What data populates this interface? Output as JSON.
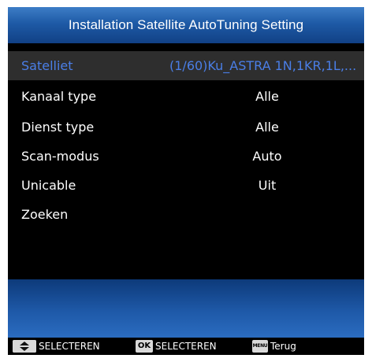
{
  "header": {
    "title": "Installation Satellite AutoTuning Setting"
  },
  "menu": {
    "items": [
      {
        "label": "Satelliet",
        "value": "(1/60)Ku_ASTRA 1N,1KR,1L,..."
      },
      {
        "label": "Kanaal type",
        "value": "Alle"
      },
      {
        "label": "Dienst type",
        "value": "Alle"
      },
      {
        "label": "Scan-modus",
        "value": "Auto"
      },
      {
        "label": "Unicable",
        "value": "Uit"
      },
      {
        "label": "Zoeken",
        "value": ""
      }
    ]
  },
  "help_bar": {
    "updown_icon": "up-down-arrows-icon",
    "updown_label": "SELECTEREN",
    "ok_key": "OK",
    "ok_label": "SELECTEREN",
    "menu_key": "MENU",
    "menu_label": "Terug"
  },
  "colors": {
    "title_gradient_top": "#3d7dc6",
    "title_gradient_bottom": "#114185",
    "selected_text": "#4a7ee6",
    "normal_text": "#ffffff",
    "background": "#000000",
    "info_panel": "#1e59a8"
  }
}
